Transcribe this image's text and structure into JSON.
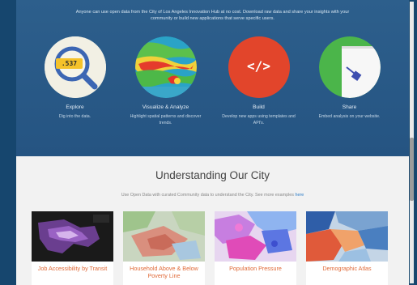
{
  "hero": {
    "intro": "Anyone can use open data from the City of Los Angeles Innovation Hub at no cost. Download raw data and share your insights with your community or build new applications that serve specific users."
  },
  "features": [
    {
      "title": "Explore",
      "desc": "Dig into the data.",
      "icon": "magnifier-icon",
      "value": ".537"
    },
    {
      "title": "Visualize & Analyze",
      "desc": "Highlight spatial patterns and discover trends.",
      "icon": "heatmap-icon"
    },
    {
      "title": "Build",
      "desc": "Develop new apps using templates and API's.",
      "icon": "code-icon",
      "glyph": "</>"
    },
    {
      "title": "Share",
      "desc": "Embed analysis on your website.",
      "icon": "share-map-icon"
    }
  ],
  "section": {
    "title": "Understanding Our City",
    "subtitle": "Use Open Data with curated Community data to understand the City. See more examples",
    "link": "here"
  },
  "cards": [
    {
      "title": "Job Accessibility by Transit"
    },
    {
      "title": "Household Above & Below Poverty Line"
    },
    {
      "title": "Population Pressure"
    },
    {
      "title": "Demographic Atlas"
    }
  ],
  "colors": {
    "hero_bg": "#2d5f8c",
    "accent_orange": "#e06a38",
    "link_blue": "#2c7cc7"
  }
}
